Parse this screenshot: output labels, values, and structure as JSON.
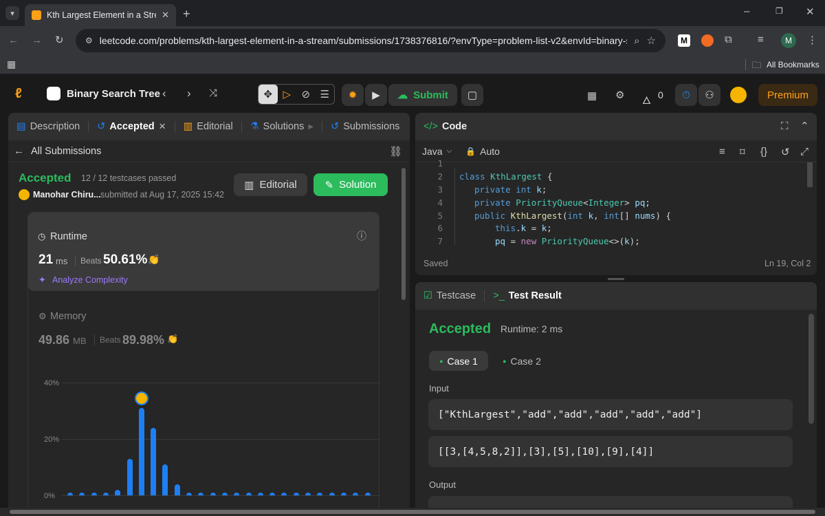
{
  "browser": {
    "tab_title": "Kth Largest Element in a Stream",
    "url": "leetcode.com/problems/kth-largest-element-in-a-stream/submissions/1738376816/?envType=problem-list-v2&envId=binary-s...",
    "bookmarks_label": "All Bookmarks",
    "ext_m_label": "M",
    "profile_label": "M"
  },
  "nav": {
    "problem_list_title": "Binary Search Tree",
    "submit_label": "Submit",
    "streak_count": "0",
    "premium_label": "Premium"
  },
  "left_tabs": [
    {
      "label": "Description"
    },
    {
      "label": "Accepted"
    },
    {
      "label": "Editorial"
    },
    {
      "label": "Solutions"
    },
    {
      "label": "Submissions"
    }
  ],
  "submission": {
    "back_label": "All Submissions",
    "status": "Accepted",
    "testcases": "12 / 12 testcases passed",
    "author": "Manohar Chiru...",
    "submitted_at": "submitted at Aug 17, 2025 15:42",
    "editorial_btn": "Editorial",
    "solution_btn": "Solution",
    "runtime_title": "Runtime",
    "runtime_value": "21",
    "runtime_unit": "ms",
    "beats_label": "Beats",
    "runtime_beats": "50.61%",
    "analyze_label": "Analyze Complexity",
    "memory_title": "Memory",
    "memory_value": "49.86",
    "memory_unit": "MB",
    "memory_beats": "89.98%"
  },
  "chart_data": {
    "type": "bar",
    "ylim": [
      0,
      40
    ],
    "yticks": [
      "40%",
      "20%",
      "0%"
    ],
    "values": [
      1,
      1,
      1,
      1,
      2,
      13,
      31,
      24,
      11,
      4,
      1,
      1,
      1,
      1,
      1,
      1,
      1,
      1,
      1,
      1,
      1,
      1,
      1,
      1,
      1,
      1
    ],
    "highlight_index": 6,
    "bar_color": "#1e7ff5"
  },
  "code_panel": {
    "title": "Code",
    "language": "Java",
    "auto_label": "Auto",
    "status": "Saved",
    "cursor": "Ln 19, Col 2",
    "line_numbers": [
      "1",
      "2",
      "3",
      "4",
      "5",
      "6",
      "7"
    ]
  },
  "result_panel": {
    "testcase_tab": "Testcase",
    "result_tab": "Test Result",
    "status": "Accepted",
    "runtime": "Runtime: 2 ms",
    "case1": "Case 1",
    "case2": "Case 2",
    "input_label": "Input",
    "input_line1": "[\"KthLargest\",\"add\",\"add\",\"add\",\"add\",\"add\"]",
    "input_line2": "[[3,[4,5,8,2]],[3],[5],[10],[9],[4]]",
    "output_label": "Output"
  },
  "colors": {
    "accent_green": "#2cbb5d",
    "premium_orange": "#ffa116",
    "link_blue": "#1e7ff5"
  }
}
